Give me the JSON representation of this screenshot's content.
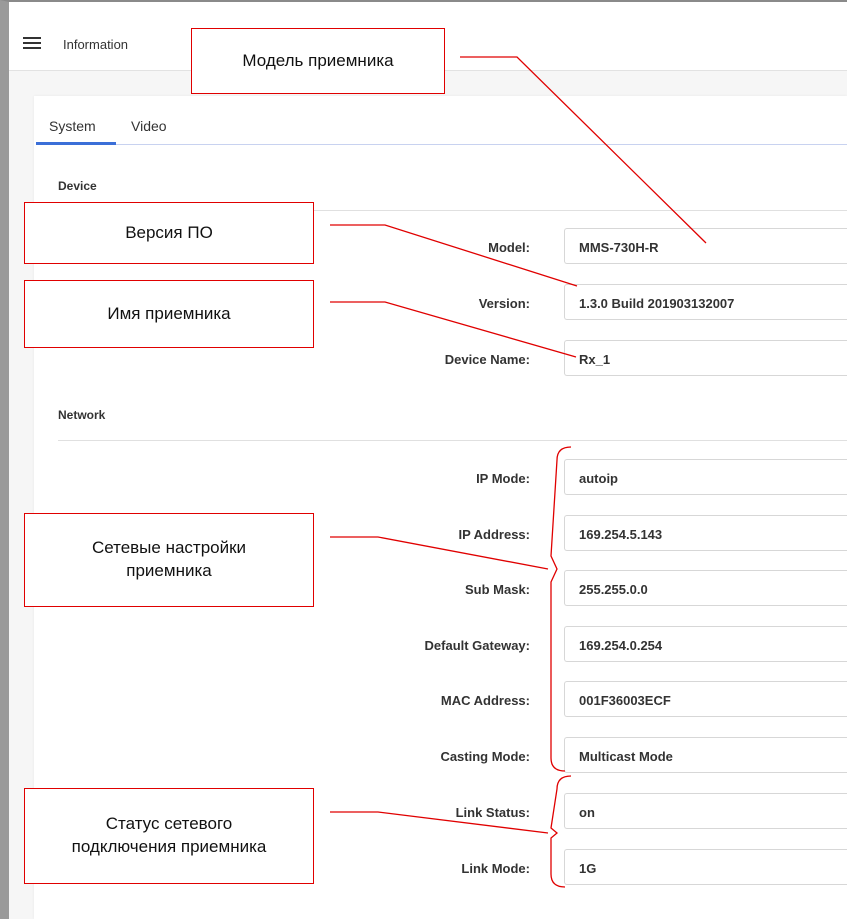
{
  "header": {
    "menu_icon": "hamburger-menu-icon",
    "title": "Information"
  },
  "tabs": [
    {
      "label": "System",
      "active": true
    },
    {
      "label": "Video",
      "active": false
    }
  ],
  "sections": {
    "device": {
      "title": "Device",
      "fields": [
        {
          "label": "Model:",
          "value": "MMS-730H-R"
        },
        {
          "label": "Version:",
          "value": "1.3.0 Build 201903132007"
        },
        {
          "label": "Device Name:",
          "value": "Rx_1"
        }
      ]
    },
    "network": {
      "title": "Network",
      "fields": [
        {
          "label": "IP Mode:",
          "value": "autoip"
        },
        {
          "label": "IP Address:",
          "value": "169.254.5.143"
        },
        {
          "label": "Sub Mask:",
          "value": "255.255.0.0"
        },
        {
          "label": "Default Gateway:",
          "value": "169.254.0.254"
        },
        {
          "label": "MAC Address:",
          "value": "001F36003ECF"
        },
        {
          "label": "Casting Mode:",
          "value": "Multicast Mode"
        },
        {
          "label": "Link Status:",
          "value": "on"
        },
        {
          "label": "Link Mode:",
          "value": "1G"
        }
      ]
    }
  },
  "callouts": {
    "model": "Модель приемника",
    "version": "Версия ПО",
    "name": "Имя приемника",
    "network_line1": "Сетевые настройки",
    "network_line2": "приемника",
    "link_line1": "Статус сетевого",
    "link_line2": "подключения приемника"
  },
  "colors": {
    "annotation": "#e00000",
    "tab_accent": "#3b6fd8"
  }
}
